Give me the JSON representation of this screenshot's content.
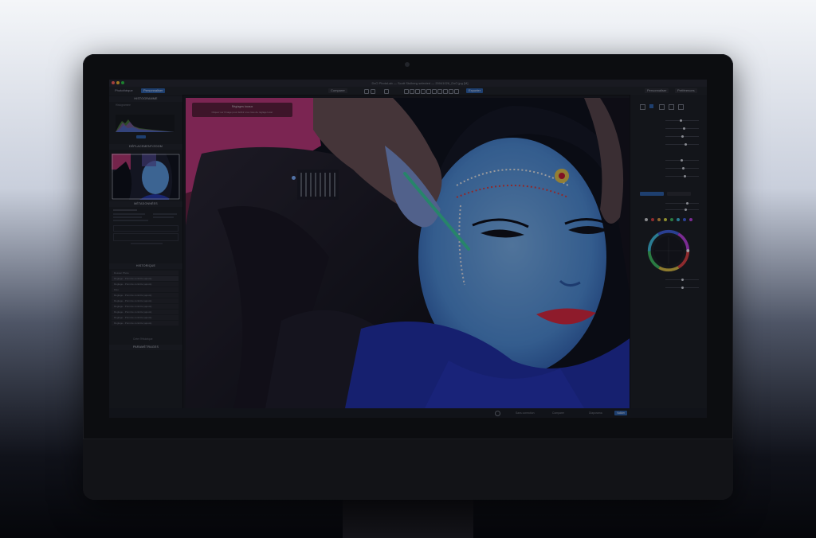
{
  "window": {
    "title": "DxO PhotoLab — Scott Stulberg selected — 20041026_DxO.jpg [M]"
  },
  "toolbar": {
    "tab_library": "Photothèque",
    "tab_customize": "Personnaliser",
    "compare_label": "Comparer",
    "export_label": "Exporter",
    "workspace_label": "Personnaliser",
    "right_label": "Préférences"
  },
  "left_panel": {
    "histogram_header": "HISTOGRAMME",
    "histogram_sub": "Histogramme",
    "navigator_header": "DÉPLACEMENT/ZOOM",
    "metadata_header": "MÉTADONNÉES",
    "history_header": "HISTORIQUE",
    "history_items": [
      "Dossier Photo",
      "Reglage - Point de contrôle (ajouté)",
      "Reglage - Point de contrôle (ajouté)",
      "Flou",
      "Reglage - Point de contrôle (ajouté)",
      "Reglage - Point de contrôle (ajouté)",
      "Reglage - Point de contrôle (ajouté)",
      "Reglage - Point de contrôle (ajouté)",
      "Reglage - Point de contrôle (ajouté)",
      "Reglage - Point de contrôle (ajouté)"
    ],
    "snapshot_label": "Créer l'Historique",
    "versions_header": "PARAMÈTRAGES"
  },
  "photo_overlay": {
    "title": "Réglages locaux",
    "text": "Cliquez sur l'image pour définir une zone de réglage local."
  },
  "status_bar": {
    "btn1": "Sans correction",
    "btn2": "Comparer",
    "btn3": "Diaporama",
    "btn4": "Valider"
  },
  "colors": {
    "accent": "#2c5fa8",
    "panel_bg": "#1b1c20",
    "screen_bg": "#17181c"
  }
}
